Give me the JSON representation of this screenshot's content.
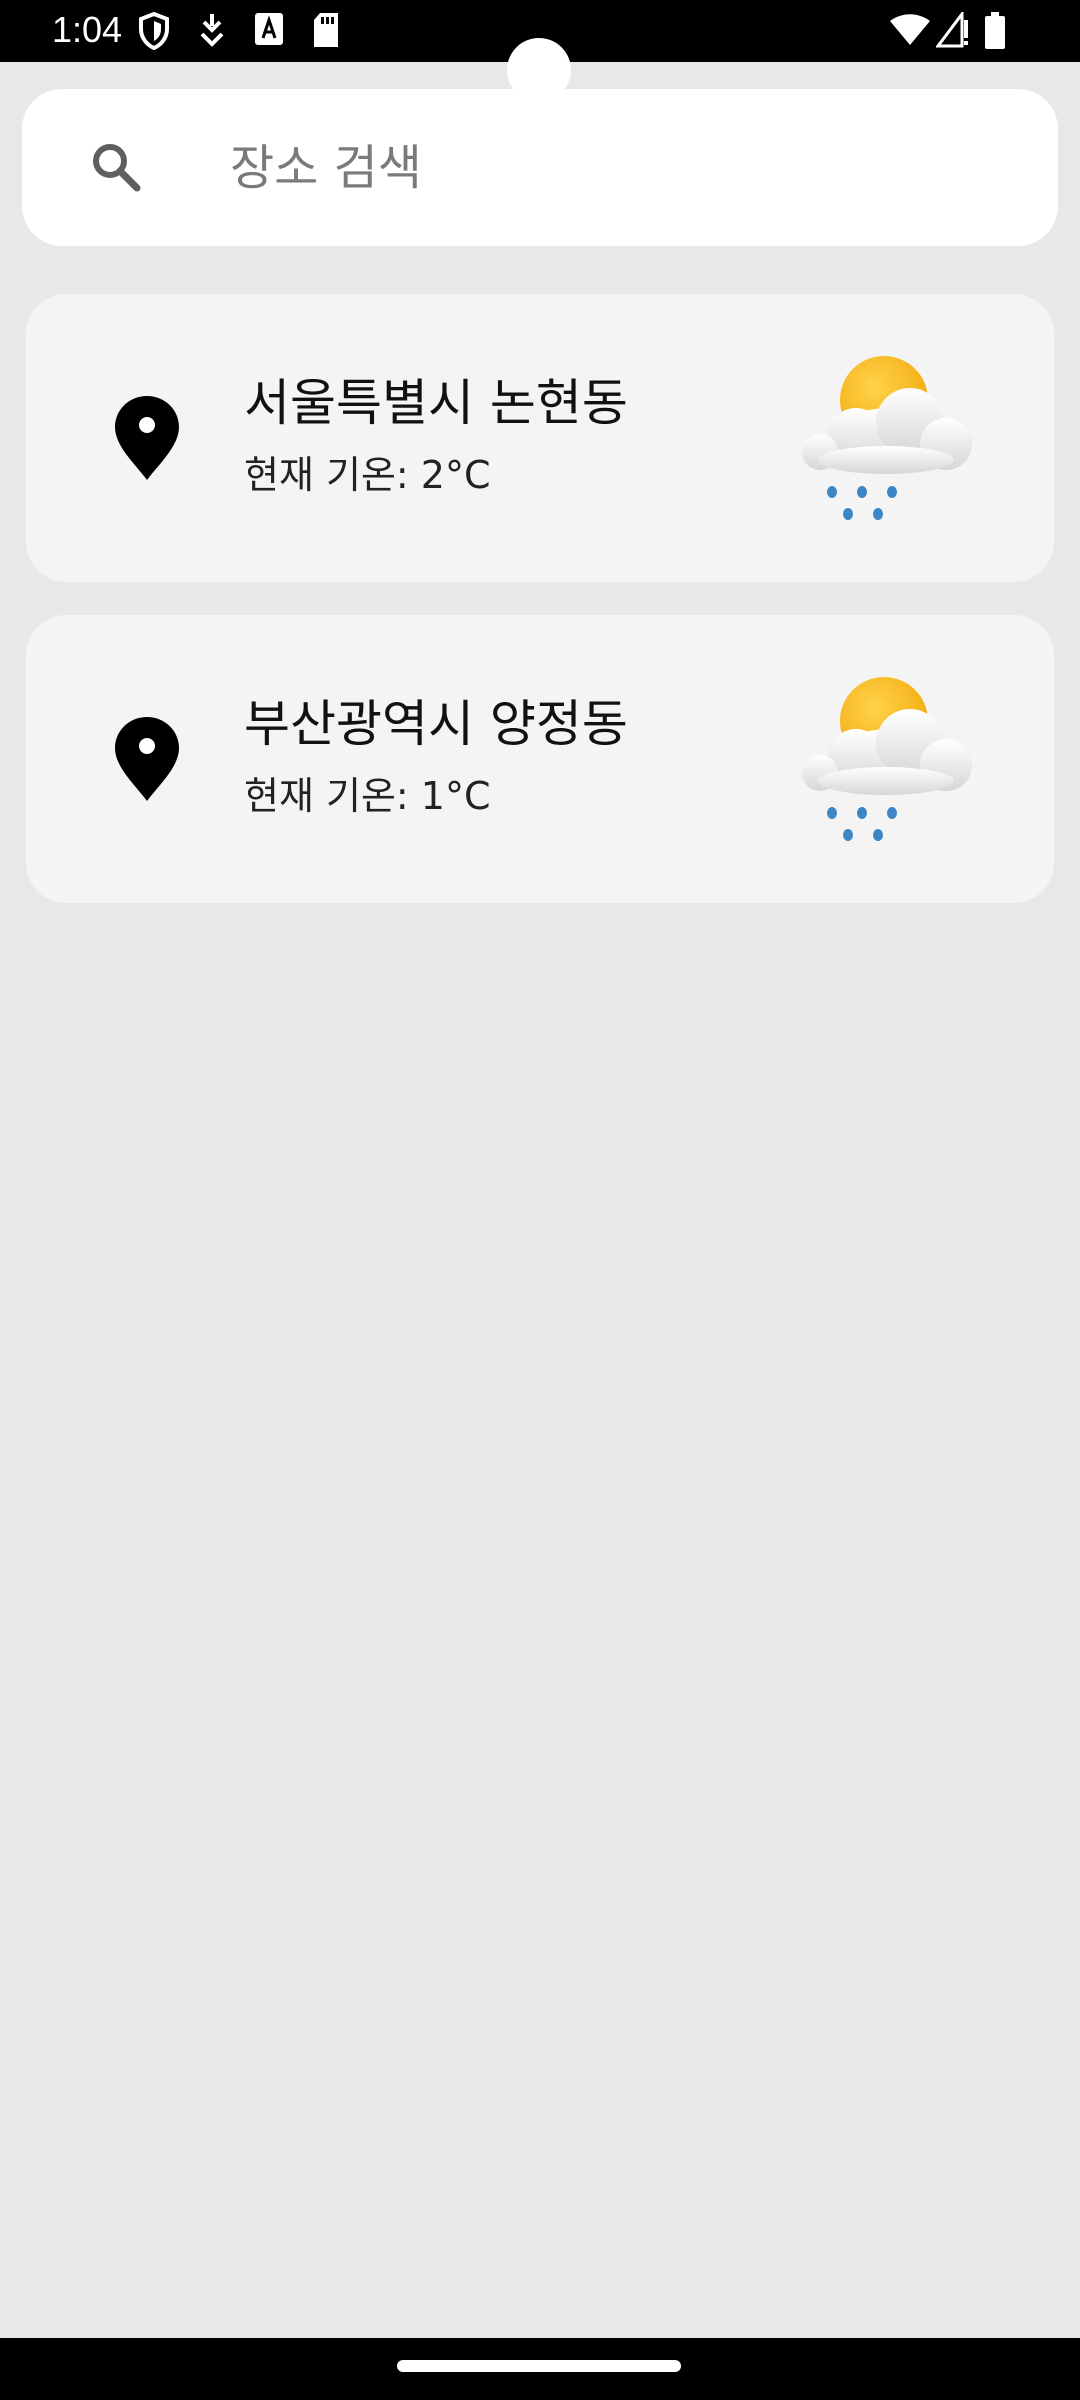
{
  "status_bar": {
    "time": "1:04",
    "left_icons": [
      "shield-icon",
      "download-arrow-icon",
      "text-a-icon",
      "sd-card-icon"
    ],
    "right_icons": [
      "wifi-icon",
      "signal-icon",
      "battery-icon"
    ]
  },
  "search": {
    "placeholder": "장소 검색",
    "value": ""
  },
  "locations": [
    {
      "name": "서울특별시 논현동",
      "temperature": "현재 기온: 2°C",
      "weather_icon": "sun-cloud-rain-icon"
    },
    {
      "name": "부산광역시 양정동",
      "temperature": "현재 기온: 1°C",
      "weather_icon": "sun-cloud-rain-icon"
    }
  ],
  "colors": {
    "background": "#e8e8e8",
    "card": "#f4f4f4",
    "search_bg": "#ffffff",
    "sun": "#f7b31a",
    "rain": "#3b86c4"
  }
}
